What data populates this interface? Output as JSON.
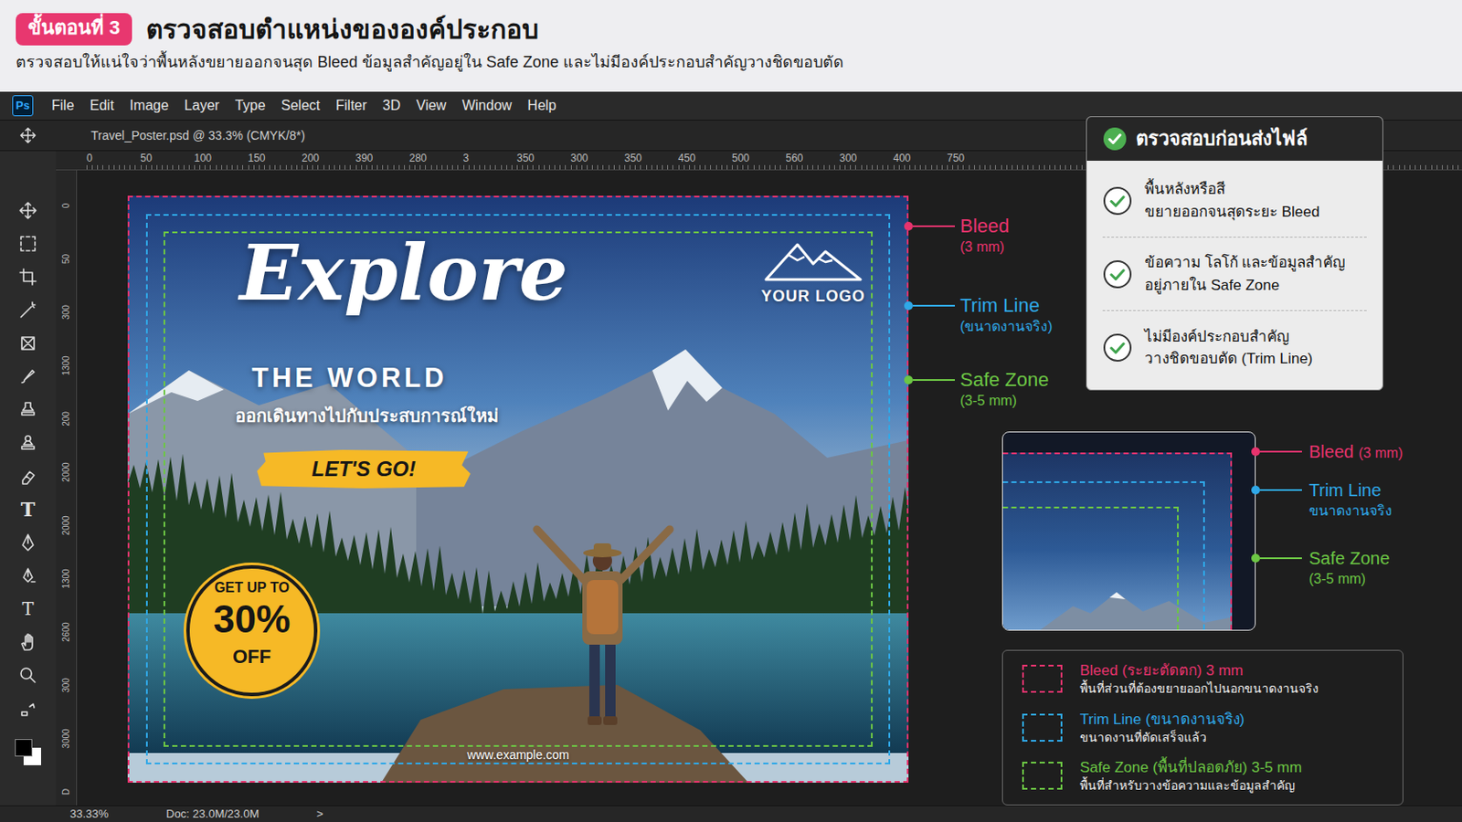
{
  "header": {
    "step_badge": "ขั้นตอนที่ 3",
    "title": "ตรวจสอบตำแหน่งขององค์ประกอบ",
    "subtitle": "ตรวจสอบให้แน่ใจว่าพื้นหลังขยายออกจนสุด Bleed ข้อมูลสำคัญอยู่ใน Safe Zone และไม่มีองค์ประกอบสำคัญวางชิดขอบตัด"
  },
  "app": {
    "logo": "Ps",
    "menu": [
      "File",
      "Edit",
      "Image",
      "Layer",
      "Type",
      "Select",
      "Filter",
      "3D",
      "View",
      "Window",
      "Help"
    ],
    "document_tab": "Travel_Poster.psd @ 33.3% (CMYK/8*)",
    "ruler_top": [
      "0",
      "50",
      "100",
      "150",
      "200",
      "390",
      "280",
      "3",
      "350",
      "300",
      "350",
      "450",
      "500",
      "560",
      "300",
      "400",
      "750"
    ],
    "ruler_left": [
      "0",
      "50",
      "300",
      "1300",
      "200",
      "2000",
      "2000",
      "1300",
      "2600",
      "300",
      "3000",
      "D"
    ],
    "text_tool": "T",
    "vertical_text_tool": "T"
  },
  "poster": {
    "headline": "Explore",
    "subheadline": "THE WORLD",
    "tagline": "ออกเดินทางไปกับประสบการณ์ใหม่",
    "cta": "LET'S GO!",
    "logo": "YOUR LOGO",
    "badge": {
      "line1": "GET UP TO",
      "value": "30%",
      "line2": "OFF"
    },
    "url": "www.example.com"
  },
  "guides": [
    {
      "label": "Bleed",
      "detail": "(3 mm)",
      "color": "#e8336d"
    },
    {
      "label": "Trim Line",
      "detail": "(ขนาดงานจริง)",
      "color": "#2fa8e8"
    },
    {
      "label": "Safe Zone",
      "detail": "(3-5 mm)",
      "color": "#6cc644"
    }
  ],
  "checklist": {
    "title": "ตรวจสอบก่อนส่งไฟล์",
    "items": [
      {
        "line1": "พื้นหลังหรือสี",
        "line2": "ขยายออกจนสุดระยะ Bleed",
        "checked": true
      },
      {
        "line1": "ข้อความ โลโก้ และข้อมูลสำคัญ",
        "line2": "อยู่ภายใน Safe Zone",
        "checked": true
      },
      {
        "line1": "ไม่มีองค์ประกอบสำคัญ",
        "line2": "วางชิดขอบตัด (Trim Line)",
        "checked": true
      }
    ]
  },
  "zoom_guides": [
    {
      "label": "Bleed",
      "detail": "(3 mm)",
      "color": "#e8336d"
    },
    {
      "label": "Trim Line",
      "detail": "ขนาดงานจริง",
      "color": "#2fa8e8"
    },
    {
      "label": "Safe Zone",
      "detail": "(3-5 mm)",
      "color": "#6cc644"
    }
  ],
  "legend": [
    {
      "title": "Bleed (ระยะตัดตก) 3 mm",
      "description": "พื้นที่ส่วนที่ต้องขยายออกไปนอกขนาดงานจริง",
      "color": "#e8336d"
    },
    {
      "title": "Trim Line (ขนาดงานจริง)",
      "description": "ขนาดงานที่ตัดเสร็จแล้ว",
      "color": "#2fa8e8"
    },
    {
      "title": "Safe Zone (พื้นที่ปลอดภัย) 3-5 mm",
      "description": "พื้นที่สำหรับวางข้อความและข้อมูลสำคัญ",
      "color": "#6cc644"
    }
  ],
  "status_bar": {
    "zoom": "33.33%",
    "doc": "Doc: 23.0M/23.0M",
    "arrow": ">"
  }
}
